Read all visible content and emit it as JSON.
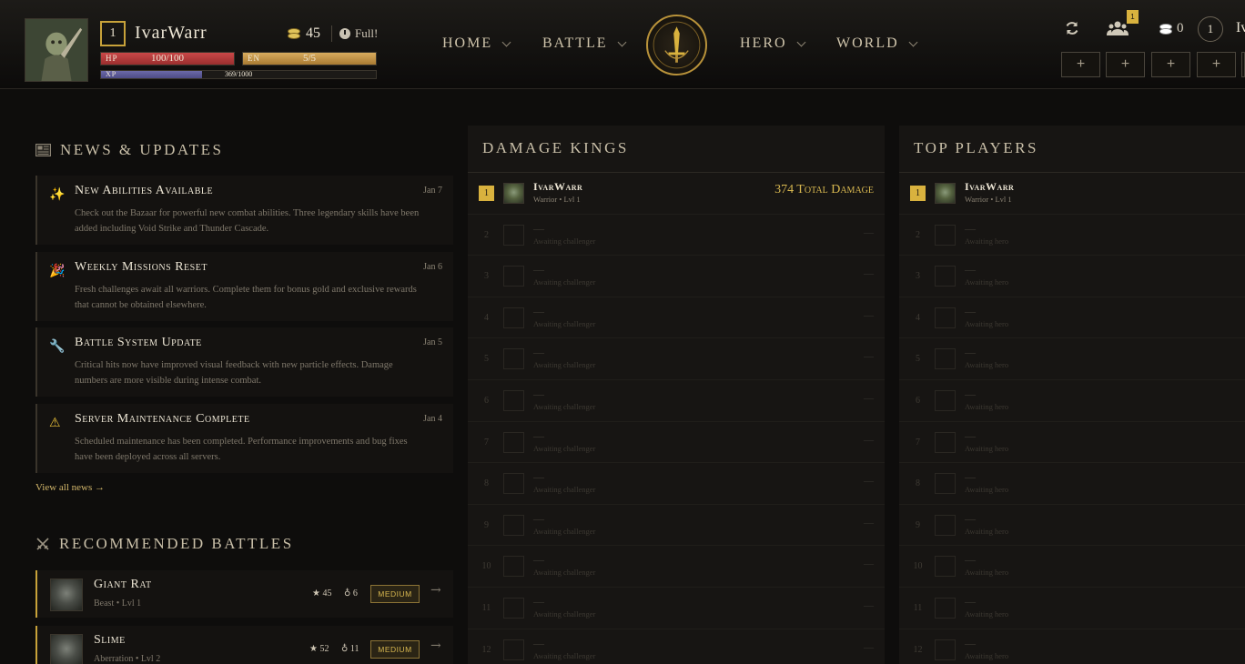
{
  "player": {
    "level": "1",
    "name": "IvarWarr",
    "gold": "45",
    "status": "Full!",
    "hp": {
      "label": "HP",
      "value": "100/100",
      "fraction": 1.0
    },
    "en": {
      "label": "EN",
      "value": "5/5",
      "fraction": 1.0
    },
    "xp": {
      "label": "XP",
      "value": "369/1000",
      "fraction": 0.369
    }
  },
  "nav": {
    "items": [
      {
        "label": "HOME"
      },
      {
        "label": "BATTLE"
      },
      {
        "label": "HERO"
      },
      {
        "label": "WORLD"
      }
    ]
  },
  "topright": {
    "users_badge": "1",
    "gold": "0",
    "level": "1",
    "name_partial": "IvarWarr",
    "slots": [
      "+",
      "+",
      "+",
      "+"
    ]
  },
  "news": {
    "title": "NEWS & UPDATES",
    "items": [
      {
        "icon": "sparkles-icon",
        "glyph": "✨",
        "title": "New Abilities Available",
        "date": "Jan 7",
        "body": "Check out the Bazaar for powerful new combat abilities. Three legendary skills have been added including Void Strike and Thunder Cascade."
      },
      {
        "icon": "party-popper-icon",
        "glyph": "🎉",
        "title": "Weekly Missions Reset",
        "date": "Jan 6",
        "body": "Fresh challenges await all warriors. Complete them for bonus gold and exclusive rewards that cannot be obtained elsewhere."
      },
      {
        "icon": "wrench-icon",
        "glyph": "🔧",
        "title": "Battle System Update",
        "date": "Jan 5",
        "body": "Critical hits now have improved visual feedback with new particle effects. Damage numbers are more visible during intense combat."
      },
      {
        "icon": "warning-icon",
        "glyph": "⚠",
        "title": "Server Maintenance Complete",
        "date": "Jan 4",
        "body": "Scheduled maintenance has been completed. Performance improvements and bug fixes have been deployed across all servers."
      }
    ],
    "view_all": "View all news →"
  },
  "battles": {
    "title": "RECOMMENDED BATTLES",
    "items": [
      {
        "name": "Giant Rat",
        "sub": "Beast • Lvl 1",
        "xp": "45",
        "gold": "6",
        "difficulty": "MEDIUM"
      },
      {
        "name": "Slime",
        "sub": "Aberration • Lvl 2",
        "xp": "52",
        "gold": "11",
        "difficulty": "MEDIUM"
      }
    ]
  },
  "damage_kings": {
    "title": "DAMAGE KINGS",
    "first": {
      "rank": "1",
      "name": "IvarWarr",
      "sub": "Warrior • Lvl 1",
      "value": "374 Total Damage"
    },
    "empty_name": "—",
    "empty_sub": "Awaiting challenger",
    "empty_value": "—",
    "ranks": [
      "2",
      "3",
      "4",
      "5",
      "6",
      "7",
      "8",
      "9",
      "10",
      "11",
      "12"
    ]
  },
  "top_players": {
    "title": "TOP PLAYERS",
    "first": {
      "rank": "1",
      "name": "IvarWarr",
      "sub": "Warrior • Lvl 1"
    },
    "empty_name": "—",
    "empty_sub": "Awaiting hero",
    "ranks": [
      "2",
      "3",
      "4",
      "5",
      "6",
      "7",
      "8",
      "9",
      "10",
      "11",
      "12"
    ]
  },
  "colors": {
    "accent_gold": "#d9b23e",
    "hp_red": "#c94848",
    "en_orange": "#d8ac5e",
    "xp_purple": "#6c6aa8"
  }
}
